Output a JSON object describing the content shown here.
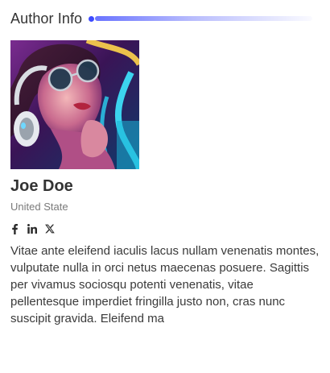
{
  "widget": {
    "title": "Author Info",
    "accent_color": "#3d4bff"
  },
  "author": {
    "photo_alt": "Author photo",
    "name": "Joe Doe",
    "location": "United State",
    "bio": "Vitae ante eleifend iaculis lacus nullam venenatis montes, vulputate nulla in orci netus maecenas posuere. Sagittis per vivamus sociosqu potenti venenatis, vitae pellentesque imperdiet fringilla justo non, cras nunc suscipit gravida. Eleifend ma"
  },
  "social": [
    {
      "icon": "facebook-icon"
    },
    {
      "icon": "linkedin-icon"
    },
    {
      "icon": "x-twitter-icon"
    }
  ]
}
